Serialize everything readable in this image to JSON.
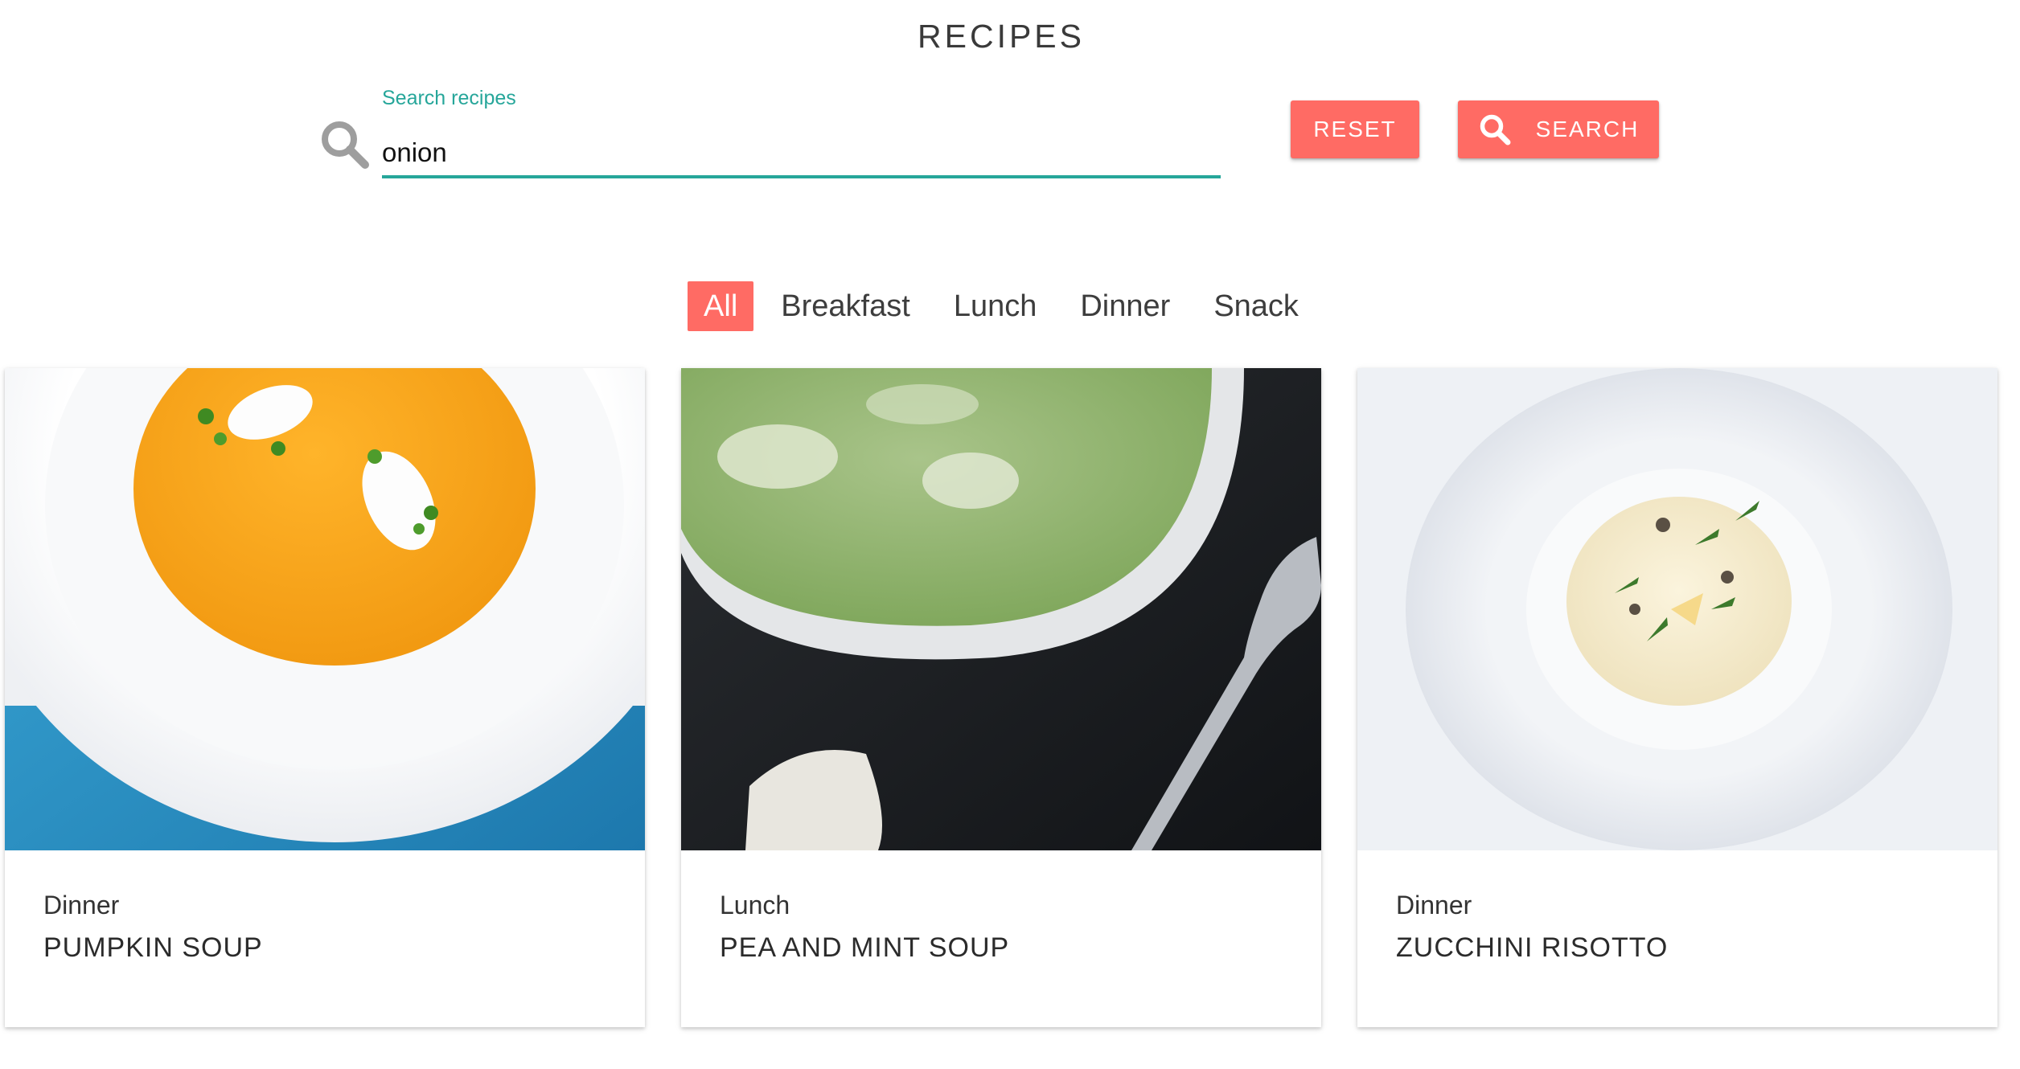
{
  "header": {
    "title": "RECIPES"
  },
  "search": {
    "label": "Search recipes",
    "value": "onion",
    "icon": "search-icon"
  },
  "buttons": {
    "reset_label": "RESET",
    "search_label": "SEARCH",
    "search_icon": "search-icon"
  },
  "filters": {
    "items": [
      "All",
      "Breakfast",
      "Lunch",
      "Dinner",
      "Snack"
    ],
    "active": "All"
  },
  "colors": {
    "accent": "#ff6b64",
    "teal": "#26a69a"
  },
  "recipes": [
    {
      "category": "Dinner",
      "title": "PUMPKIN SOUP",
      "image": "pumpkin-soup-image"
    },
    {
      "category": "Lunch",
      "title": "PEA AND MINT SOUP",
      "image": "pea-mint-soup-image"
    },
    {
      "category": "Dinner",
      "title": "ZUCCHINI RISOTTO",
      "image": "zucchini-risotto-image"
    }
  ]
}
